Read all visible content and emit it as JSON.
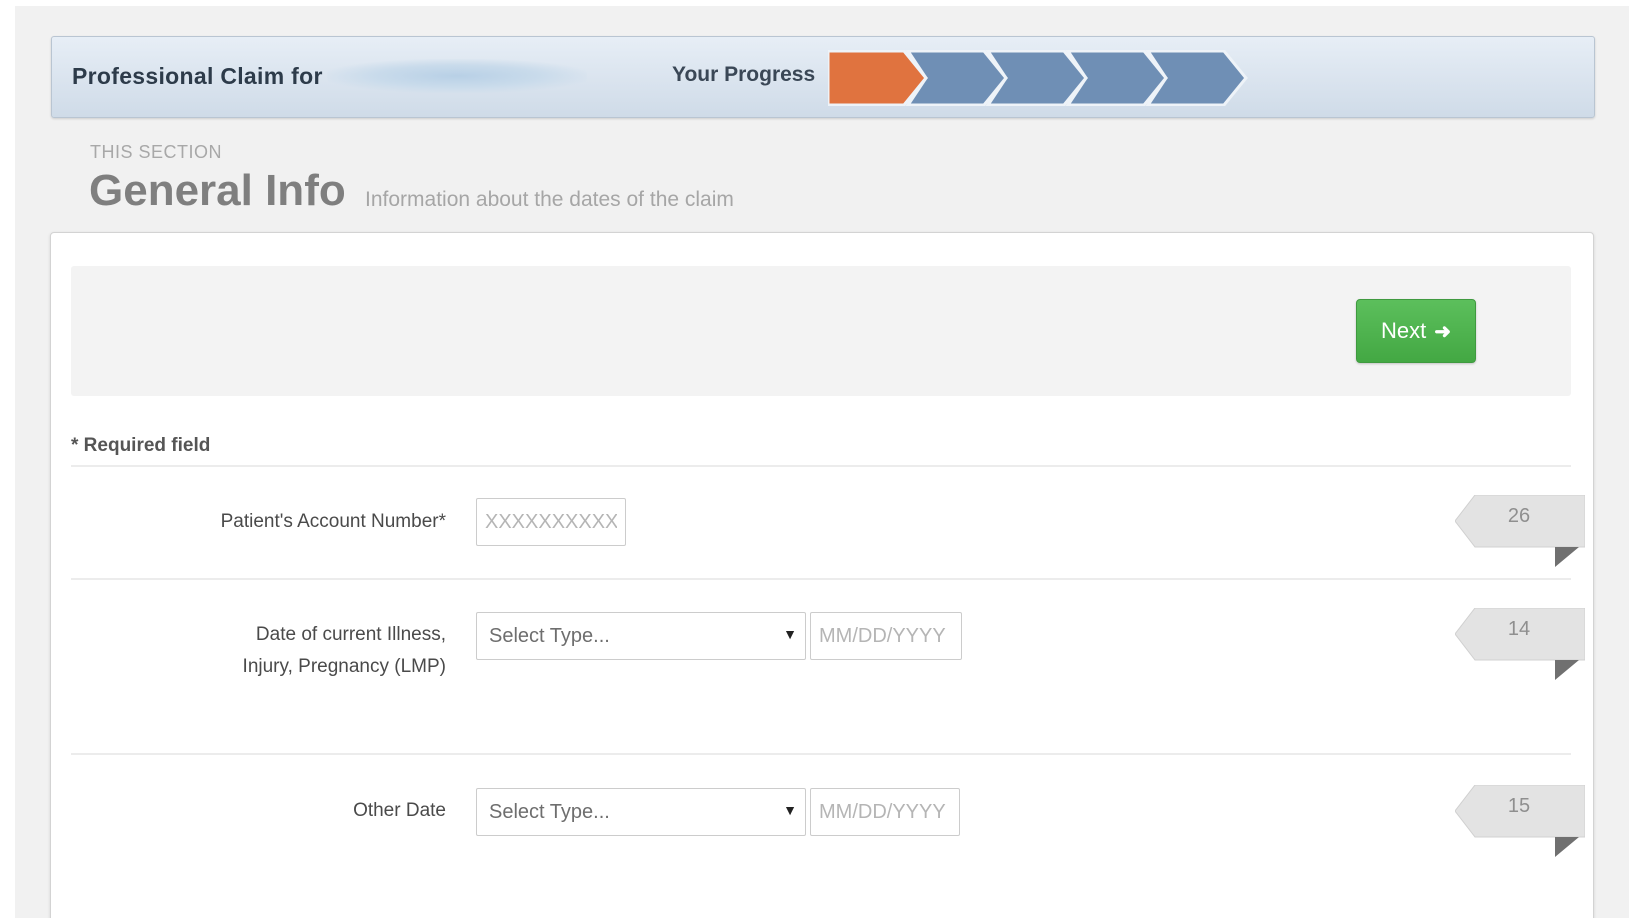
{
  "header": {
    "claim_title": "Professional Claim for",
    "progress_label": "Your Progress",
    "progress": {
      "total_steps": 5,
      "current_step": 1,
      "active_color": "#e0733f",
      "inactive_color": "#6f8fb5"
    }
  },
  "section": {
    "kicker": "THIS SECTION",
    "title": "General Info",
    "description": "Information about the dates of the claim"
  },
  "toolbar": {
    "next_label": "Next",
    "next_icon": "arrow-right-icon",
    "next_color": "#4cae4c"
  },
  "form": {
    "required_note": "* Required field",
    "fields": [
      {
        "label": "Patient's Account Number*",
        "input_placeholder": "XXXXXXXXXX",
        "box_number": "26"
      },
      {
        "label_line1": "Date of current Illness,",
        "label_line2": "Injury, Pregnancy (LMP)",
        "select_value": "Select Type...",
        "date_placeholder": "MM/DD/YYYY",
        "box_number": "14"
      },
      {
        "label": "Other Date",
        "select_value": "Select Type...",
        "date_placeholder": "MM/DD/YYYY",
        "box_number": "15"
      }
    ]
  }
}
